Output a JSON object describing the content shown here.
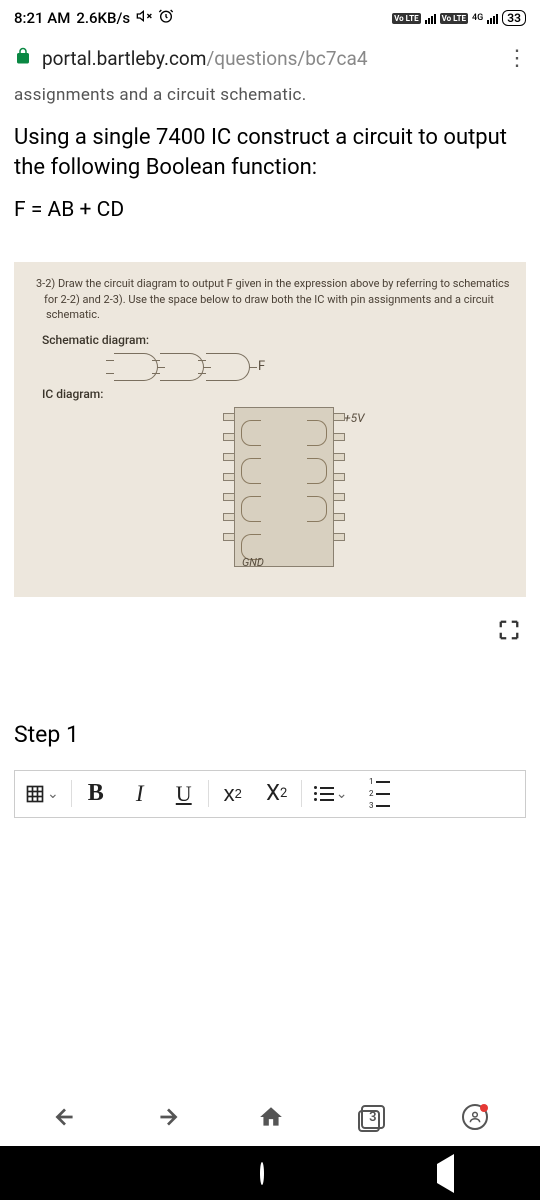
{
  "statusBar": {
    "time": "8:21 AM",
    "speed": "2.6KB/s",
    "networkLabel1": "Vo LTE",
    "networkLabel2": "Vo LTE",
    "networkType": "4G",
    "battery": "33"
  },
  "urlBar": {
    "domain": "portal.bartleby.com",
    "path": "/questions/bc7ca4"
  },
  "page": {
    "partialHeader": "assignments and a circuit schematic.",
    "questionLine1": "Using a single 7400 IC construct a circuit to output the following Boolean function:",
    "formula": "F = AB + CD"
  },
  "worksheet": {
    "instruction1": "3-2) Draw the circuit diagram to output F given in the expression above by referring to schematics",
    "instruction2": "for 2-2) and 2-3). Use the space below to draw both the IC with pin assignments and a circuit",
    "instruction3": "schematic.",
    "schematicLabel": "Schematic diagram:",
    "outputLabel": "F",
    "icLabel": "IC diagram:",
    "voltageLabel": "+5V",
    "gndLabel": "GND"
  },
  "answer": {
    "stepTitle": "Step 1"
  },
  "toolbar": {
    "bold": "B",
    "italic": "I",
    "underline": "U",
    "superscript": "x",
    "superscriptExp": "2",
    "subscript": "X",
    "subscriptExp": "2"
  },
  "browserNav": {
    "tabCount": "3"
  }
}
